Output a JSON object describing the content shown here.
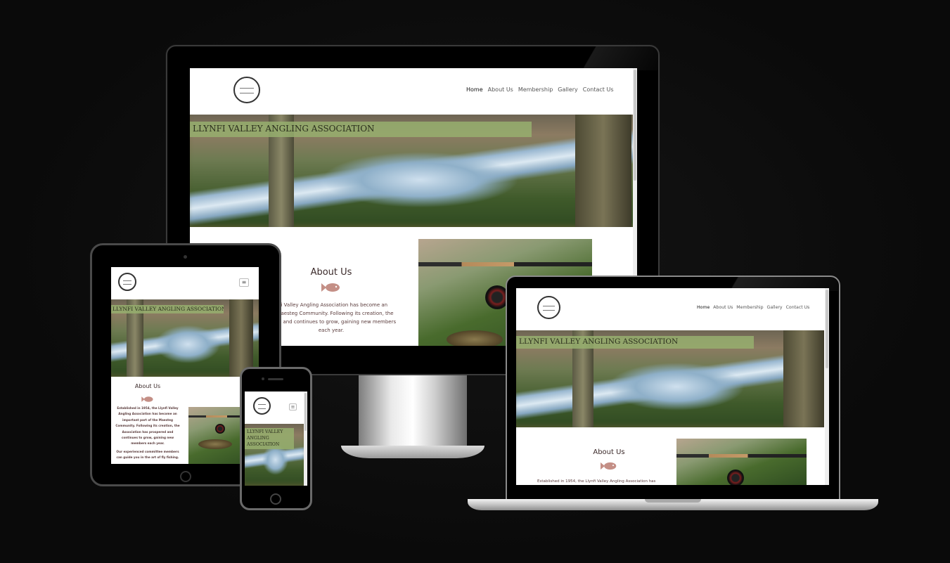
{
  "site": {
    "title": "LLYNFI VALLEY ANGLING ASSOCIATION",
    "title_short_lines": [
      "LLYNFI VALLEY",
      "ANGLING",
      "ASSOCIATION"
    ],
    "nav": [
      "Home",
      "About Us",
      "Membership",
      "Gallery",
      "Contact Us"
    ],
    "menu_icon": "hamburger-icon",
    "about": {
      "heading": "About Us",
      "icon": "fish-icon",
      "desktop_lines": [
        "the Llynfi Valley Angling Association has become an",
        "he Maesteg Community. Following its creation, the",
        "pered and continues to grow, gaining new members",
        "each year."
      ],
      "laptop_line": "Established in 1954, the Llynfi Valley Angling Association has",
      "tablet_lines": [
        "Established in 1954, the Llynfi Valley",
        "Angling Association has become an",
        "important part of the Maesteg",
        "Community. Following its creation, the",
        "Association has prospered and",
        "continues to grow, gaining new",
        "members each year."
      ],
      "tablet_lines2": [
        "Our experienced committee members",
        "can guide you in the art of fly fishing."
      ]
    }
  },
  "colors": {
    "background": "#0b0b0b",
    "title_band": "#96af6e",
    "heading": "#3b2a2a",
    "fish_icon": "#c48f86"
  }
}
